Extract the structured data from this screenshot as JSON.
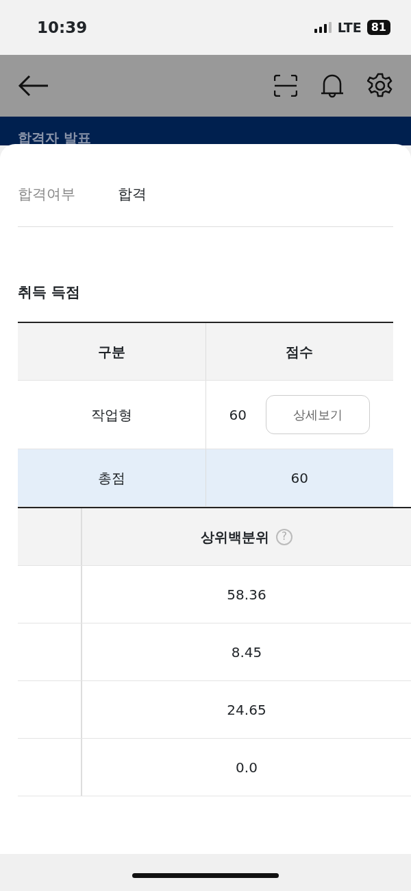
{
  "status_bar": {
    "time": "10:39",
    "network": "LTE",
    "battery": "81"
  },
  "header": {
    "title": "합격자 발표"
  },
  "result": {
    "label": "합격여부",
    "value": "합격"
  },
  "score_section": {
    "title": "취득 득점",
    "columns": [
      "구분",
      "점수"
    ],
    "rows": [
      {
        "kind": "detail",
        "category": "작업형",
        "score": "60",
        "button": "상세보기"
      },
      {
        "kind": "total",
        "category": "총점",
        "score": "60"
      }
    ]
  },
  "percentile_table": {
    "column": "상위백분위",
    "help_icon": "?",
    "rows": [
      "58.36",
      "8.45",
      "24.65",
      "0.0"
    ]
  }
}
